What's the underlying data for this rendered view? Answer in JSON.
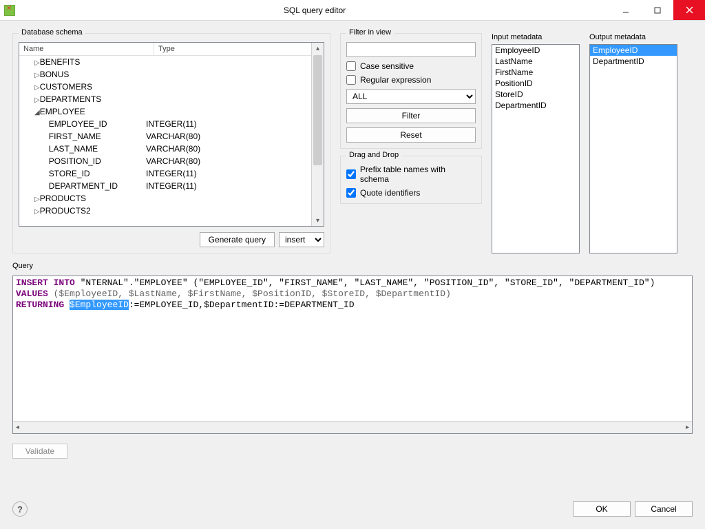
{
  "window": {
    "title": "SQL query editor"
  },
  "schema": {
    "group_label": "Database schema",
    "cols": {
      "name": "Name",
      "type": "Type"
    },
    "rows": [
      {
        "level": 1,
        "arrow": "▷",
        "name": "BENEFITS",
        "type": ""
      },
      {
        "level": 1,
        "arrow": "▷",
        "name": "BONUS",
        "type": ""
      },
      {
        "level": 1,
        "arrow": "▷",
        "name": "CUSTOMERS",
        "type": ""
      },
      {
        "level": 1,
        "arrow": "▷",
        "name": "DEPARTMENTS",
        "type": ""
      },
      {
        "level": 1,
        "arrow": "◢",
        "name": "EMPLOYEE",
        "type": ""
      },
      {
        "level": 2,
        "arrow": "",
        "name": "EMPLOYEE_ID",
        "type": "INTEGER(11)"
      },
      {
        "level": 2,
        "arrow": "",
        "name": "FIRST_NAME",
        "type": "VARCHAR(80)"
      },
      {
        "level": 2,
        "arrow": "",
        "name": "LAST_NAME",
        "type": "VARCHAR(80)"
      },
      {
        "level": 2,
        "arrow": "",
        "name": "POSITION_ID",
        "type": "VARCHAR(80)"
      },
      {
        "level": 2,
        "arrow": "",
        "name": "STORE_ID",
        "type": "INTEGER(11)"
      },
      {
        "level": 2,
        "arrow": "",
        "name": "DEPARTMENT_ID",
        "type": "INTEGER(11)"
      },
      {
        "level": 1,
        "arrow": "▷",
        "name": "PRODUCTS",
        "type": ""
      },
      {
        "level": 1,
        "arrow": "▷",
        "name": "PRODUCTS2",
        "type": ""
      }
    ],
    "generate_btn": "Generate query",
    "query_type": "insert"
  },
  "filter": {
    "group_label": "Filter in view",
    "value": "",
    "case_sensitive_label": "Case sensitive",
    "case_sensitive": false,
    "regex_label": "Regular expression",
    "regex": false,
    "scope": "ALL",
    "filter_btn": "Filter",
    "reset_btn": "Reset"
  },
  "dnd": {
    "group_label": "Drag and Drop",
    "prefix_label": "Prefix table names with schema",
    "prefix": true,
    "quote_label": "Quote identifiers",
    "quote": true
  },
  "input_meta": {
    "label": "Input metadata",
    "items": [
      "EmployeeID",
      "LastName",
      "FirstName",
      "PositionID",
      "StoreID",
      "DepartmentID"
    ]
  },
  "output_meta": {
    "label": "Output metadata",
    "items": [
      {
        "text": "EmployeeID",
        "selected": true
      },
      {
        "text": "DepartmentID",
        "selected": false
      }
    ]
  },
  "query": {
    "label": "Query",
    "line1": {
      "k1": "INSERT INTO",
      "rest": " \"NTERNAL\".\"EMPLOYEE\" (\"EMPLOYEE_ID\", \"FIRST_NAME\", \"LAST_NAME\", \"POSITION_ID\", \"STORE_ID\", \"DEPARTMENT_ID\")"
    },
    "line2": {
      "k1": "VALUES",
      "rest": " ($EmployeeID, $LastName, $FirstName, $PositionID, $StoreID, $DepartmentID)"
    },
    "line3": {
      "k1": "RETURNING",
      "sp": " ",
      "sel": "$EmployeeID",
      "rest": ":=EMPLOYEE_ID,$DepartmentID:=DEPARTMENT_ID"
    }
  },
  "buttons": {
    "validate": "Validate",
    "ok": "OK",
    "cancel": "Cancel"
  }
}
